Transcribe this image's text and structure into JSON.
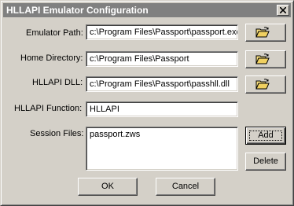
{
  "window": {
    "title": "HLLAPI Emulator Configuration"
  },
  "fields": {
    "emulator_path": {
      "label": "Emulator Path:",
      "value": "c:\\Program Files\\Passport\\passport.exe"
    },
    "home_directory": {
      "label": "Home Directory:",
      "value": "c:\\Program Files\\Passport"
    },
    "hllapi_dll": {
      "label": "HLLAPI DLL:",
      "value": "c:\\Program Files\\Passport\\passhll.dll"
    },
    "hllapi_function": {
      "label": "HLLAPI Function:",
      "value": "HLLAPI"
    },
    "session_files": {
      "label": "Session Files:",
      "items": [
        "passport.zws"
      ]
    }
  },
  "buttons": {
    "add": "Add",
    "delete": "Delete",
    "ok": "OK",
    "cancel": "Cancel"
  },
  "icons": {
    "browse": "folder-open-icon",
    "close": "close-icon"
  },
  "colors": {
    "titlebar": "#808080",
    "face": "#d4d0c8",
    "folder": "#f8e080"
  }
}
